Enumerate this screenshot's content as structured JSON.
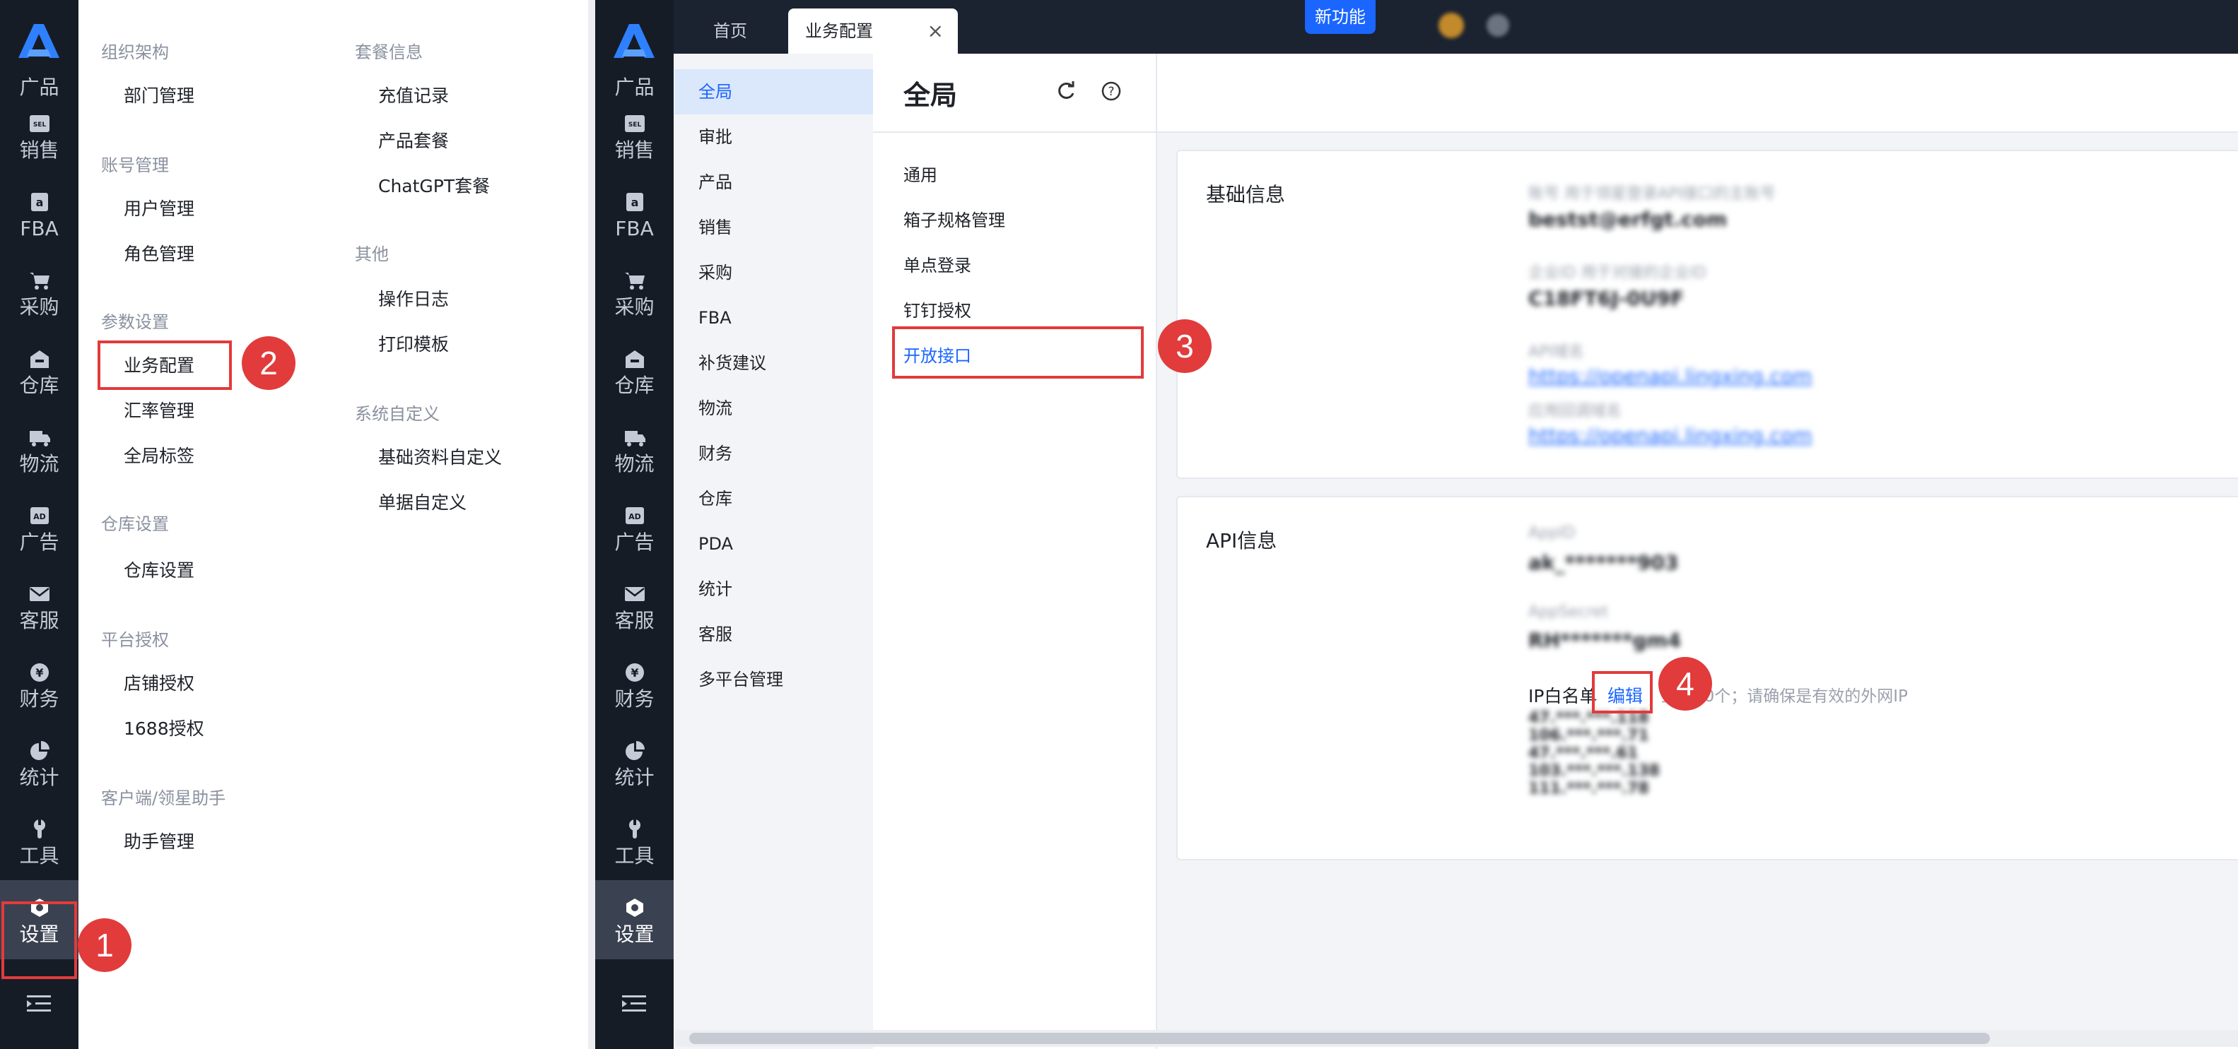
{
  "left_nav": [
    {
      "label": "广品",
      "icon": "logo-icon"
    },
    {
      "label": "销售",
      "icon": "sales-icon"
    },
    {
      "label": "FBA",
      "icon": "fba-icon"
    },
    {
      "label": "采购",
      "icon": "cart-icon"
    },
    {
      "label": "仓库",
      "icon": "warehouse-icon"
    },
    {
      "label": "物流",
      "icon": "truck-icon"
    },
    {
      "label": "广告",
      "icon": "ad-icon"
    },
    {
      "label": "客服",
      "icon": "mail-icon"
    },
    {
      "label": "财务",
      "icon": "yen-icon"
    },
    {
      "label": "统计",
      "icon": "pie-chart-icon"
    },
    {
      "label": "工具",
      "icon": "wrench-icon"
    },
    {
      "label": "设置",
      "icon": "settings-icon"
    }
  ],
  "settings_menu": {
    "col1": [
      {
        "group": "组织架构",
        "items": [
          "部门管理"
        ]
      },
      {
        "group": "账号管理",
        "items": [
          "用户管理",
          "角色管理"
        ]
      },
      {
        "group": "参数设置",
        "items": [
          "业务配置",
          "汇率管理",
          "全局标签"
        ]
      },
      {
        "group": "仓库设置",
        "items": [
          "仓库设置"
        ]
      },
      {
        "group": "平台授权",
        "items": [
          "店铺授权",
          "1688授权"
        ]
      },
      {
        "group": "客户端/领星助手",
        "items": [
          "助手管理"
        ]
      }
    ],
    "col2": [
      {
        "group": "套餐信息",
        "items": [
          "充值记录",
          "产品套餐",
          "ChatGPT套餐"
        ]
      },
      {
        "group": "其他",
        "items": [
          "操作日志",
          "打印模板"
        ]
      },
      {
        "group": "系统自定义",
        "items": [
          "基础资料自定义",
          "单据自定义"
        ]
      }
    ]
  },
  "steps": [
    "1",
    "2",
    "3",
    "4"
  ],
  "topbar": {
    "tab_home": "首页",
    "tab_active": "业务配置",
    "new_feature": "新功能"
  },
  "sub_nav": [
    "全局",
    "审批",
    "产品",
    "销售",
    "采购",
    "FBA",
    "补货建议",
    "物流",
    "财务",
    "仓库",
    "PDA",
    "统计",
    "客服",
    "多平台管理"
  ],
  "panel": {
    "title": "全局",
    "items": [
      "通用",
      "箱子规格管理",
      "单点登录",
      "钉钉授权",
      "开放接口"
    ]
  },
  "basic_info": {
    "title": "基础信息",
    "rows": [
      {
        "label": "账号  用于领星登录API接口的主账号",
        "value": "bestst@erfgt.com",
        "link": false
      },
      {
        "label": "企业ID  用于对接的企业ID",
        "value": "C18FT6J-0U9F",
        "link": false
      },
      {
        "label": "API域名",
        "value": "https://openapi.lingxing.com",
        "link": true
      },
      {
        "label": "应用回调域名",
        "value": "https://openapi.lingxing.com",
        "link": true
      }
    ]
  },
  "api_info": {
    "title": "API信息",
    "appid_label": "AppID",
    "appid_value": "ak_*******903",
    "secret_label": "AppSecret",
    "secret_value": "RH*******gm4",
    "ip_label": "IP白名单",
    "ip_edit": "编辑",
    "ip_hint": "上限20个；请确保是有效的外网IP",
    "ips": [
      "47.***.***.118",
      "106.***.***.71",
      "47.***.***.61",
      "103.***.***.138",
      "111.***.***.78"
    ]
  },
  "colors": {
    "accent": "#1a66ff",
    "sidebar": "#161c26",
    "marker": "#e23b3b"
  }
}
